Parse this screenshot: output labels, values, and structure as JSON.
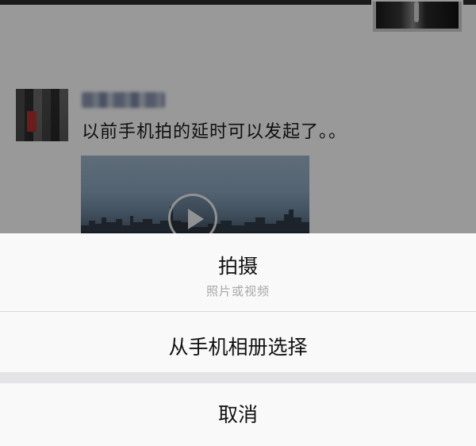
{
  "feed": {
    "post": {
      "text": "以前手机拍的延时可以发起了。。"
    }
  },
  "action_sheet": {
    "shoot": {
      "label": "拍摄",
      "sublabel": "照片或视频"
    },
    "album": {
      "label": "从手机相册选择"
    },
    "cancel": {
      "label": "取消"
    }
  },
  "colors": {
    "sheet_background": "#f9f9f9",
    "sheet_gap": "#e4e4e6",
    "overlay": "rgba(0,0,0,0.4)",
    "primary_text": "#111111",
    "secondary_text": "#a7a7a7"
  }
}
